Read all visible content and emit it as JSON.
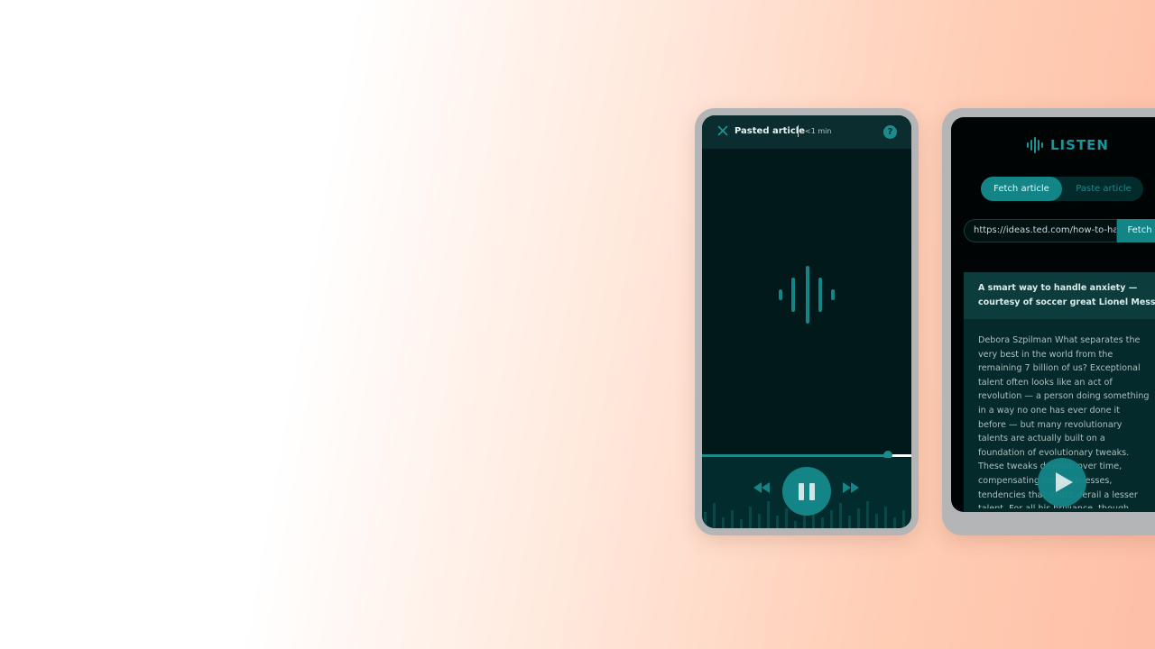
{
  "colors": {
    "accent": "#148587",
    "accent_light": "#1a9496",
    "player_bg": "#01191a",
    "app_bg": "#010404"
  },
  "player": {
    "title": "Pasted article",
    "duration": "<1 min",
    "help_icon": "question-icon",
    "close_icon": "close-icon",
    "progress": 0.89,
    "pause_icon": "pause-icon",
    "rewind_icon": "rewind-icon",
    "forward_icon": "fast-forward-icon"
  },
  "app": {
    "brand": "LISTEN",
    "logo_icon": "soundwave-icon",
    "tabs": [
      {
        "label": "Fetch article",
        "active": true
      },
      {
        "label": "Paste article",
        "active": false
      }
    ],
    "url_value": "https://ideas.ted.com/how-to-handle-anxiety",
    "fetch_label": "Fetch",
    "article": {
      "title": "A smart way to handle anxiety — courtesy of soccer great Lionel Messi",
      "body": "Debora Szpilman What separates the very best in the world from the remaining 7 billion of us? Exceptional talent often looks like an act of revolution — a person doing something in a way no one has ever done it before — but many revolutionary talents are actually built on a foundation of evolutionary tweaks. These tweaks develop over time, compensating for weaknesses, tendencies that might derail a lesser talent. For all his brilliance, though, Messi is famously"
    },
    "play_icon": "play-icon"
  }
}
